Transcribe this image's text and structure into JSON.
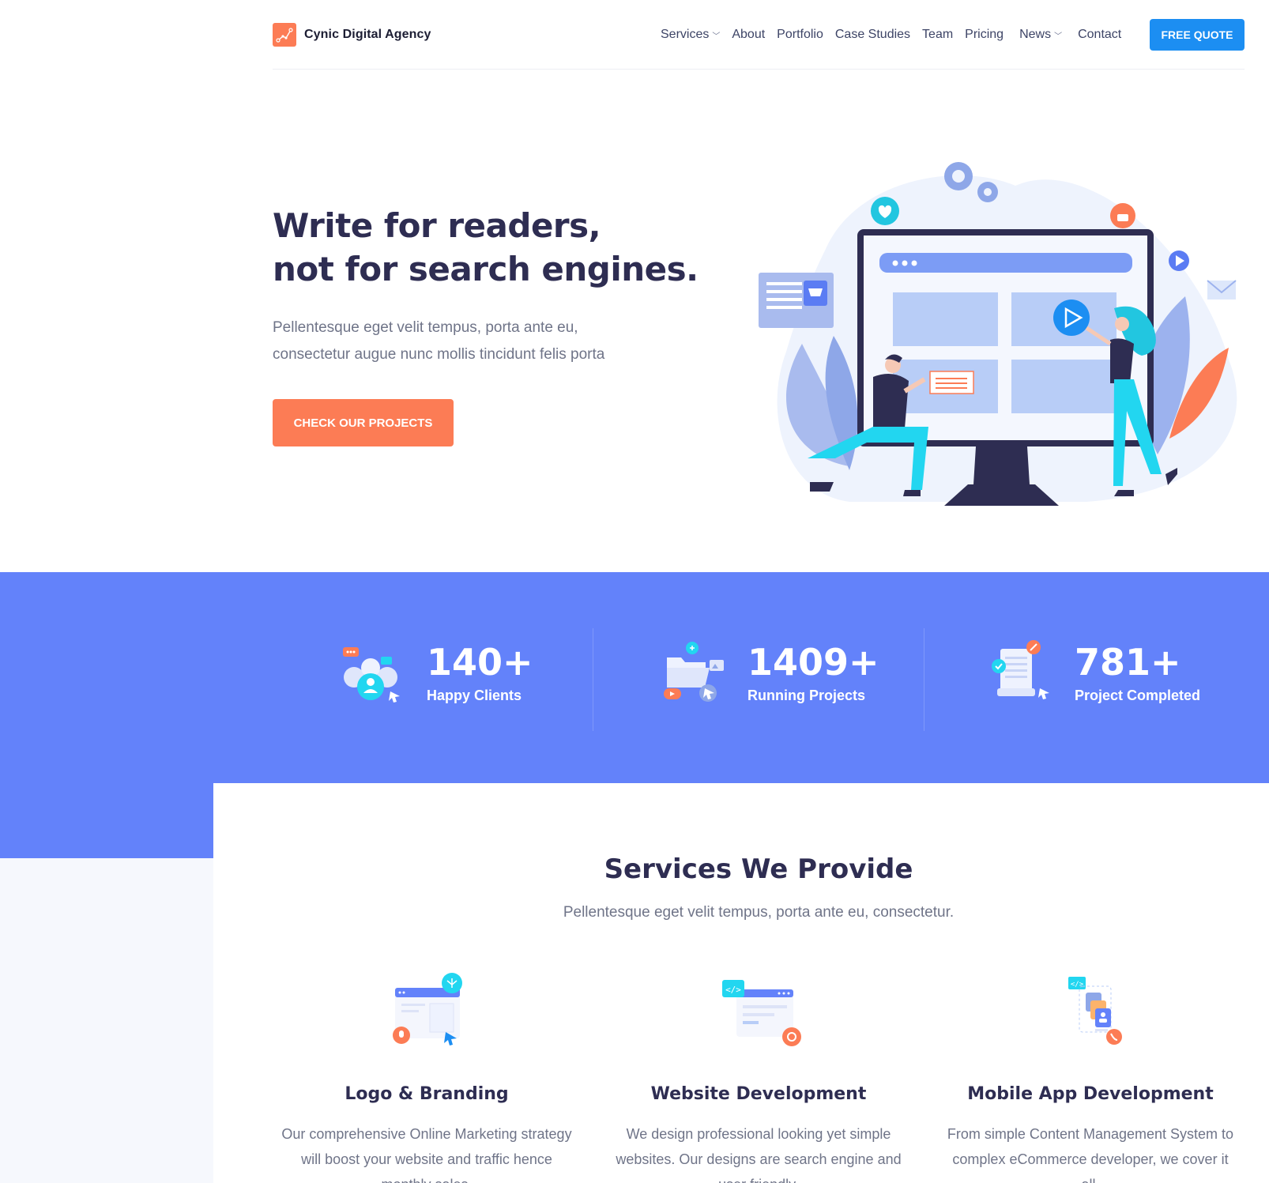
{
  "header": {
    "brand": "Cynic Digital Agency",
    "nav": [
      {
        "label": "Services",
        "has_dropdown": true
      },
      {
        "label": "About",
        "has_dropdown": false
      },
      {
        "label": "Portfolio",
        "has_dropdown": false
      },
      {
        "label": "Case Studies",
        "has_dropdown": false
      },
      {
        "label": "Team",
        "has_dropdown": false
      },
      {
        "label": "Pricing",
        "has_dropdown": false
      },
      {
        "label": "News",
        "has_dropdown": true
      },
      {
        "label": "Contact",
        "has_dropdown": false
      }
    ],
    "cta_label": "FREE QUOTE"
  },
  "hero": {
    "title_line1": "Write for readers,",
    "title_line2": "not for search engines.",
    "subtitle_line1": "Pellentesque eget velit tempus, porta ante eu,",
    "subtitle_line2": "consectetur augue nunc mollis tincidunt felis porta",
    "button_label": "CHECK OUR PROJECTS"
  },
  "stats": [
    {
      "value": "140+",
      "label": "Happy Clients",
      "icon": "clients-icon"
    },
    {
      "value": "1409+",
      "label": "Running Projects",
      "icon": "folder-icon"
    },
    {
      "value": "781+",
      "label": "Project Completed",
      "icon": "document-icon"
    }
  ],
  "services": {
    "title": "Services We Provide",
    "subtitle": "Pellentesque eget velit tempus, porta ante eu, consectetur.",
    "items": [
      {
        "name": "Logo & Branding",
        "description": "Our comprehensive Online Marketing strategy will boost your website and traffic hence monthly sales.",
        "icon": "branding-icon"
      },
      {
        "name": "Website Development",
        "description": "We design professional looking yet simple websites. Our designs are search engine and user friendly.",
        "icon": "web-dev-icon"
      },
      {
        "name": "Mobile App Development",
        "description": "From simple Content Management System to complex eCommerce developer, we cover it all.",
        "icon": "mobile-app-icon"
      }
    ]
  },
  "colors": {
    "accent_orange": "#fc7c55",
    "accent_blue": "#1c8ef2",
    "stats_band": "#6382fa",
    "heading": "#2e2d52",
    "body_text": "#6f7488"
  }
}
